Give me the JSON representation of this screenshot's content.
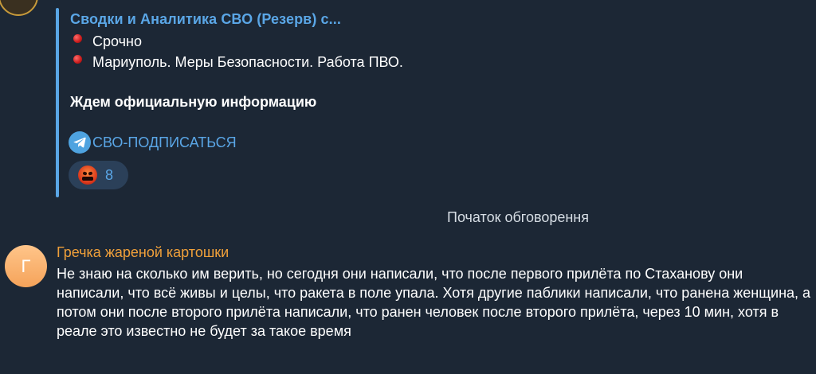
{
  "post": {
    "source_title": "Сводки и Аналитика СВО (Резерв) с...",
    "bullets": [
      "Срочно",
      "Мариуполь. Меры Безопасности. Работа ПВО."
    ],
    "bold_text": "Ждем официальную информацию",
    "subscribe_link": "СВО-ПОДПИСАТЬСЯ",
    "reaction": {
      "emoji": "enraged-face",
      "count": "8"
    },
    "colors": {
      "accent": "#5aa6e6",
      "bullet": "#d0191a"
    }
  },
  "discussion": {
    "divider_label": "Початок обговорення"
  },
  "comment": {
    "avatar_letter": "Г",
    "author": "Гречка жареной картошки",
    "text": "Не знаю на сколько им верить, но сегодня они написали, что после первого прилёта по Стаханову они написали, что всё живы и целы, что ракета в поле упала. Хотя другие паблики написали, что ранена женщина, а потом они после второго прилёта написали, что ранен человек после второго прилёта, через 10 мин, хотя в реале это известно не будет за такое время",
    "colors": {
      "author": "#f0a03a",
      "avatar": "#f8b36f"
    }
  },
  "theme": {
    "background": "#1c2735"
  }
}
